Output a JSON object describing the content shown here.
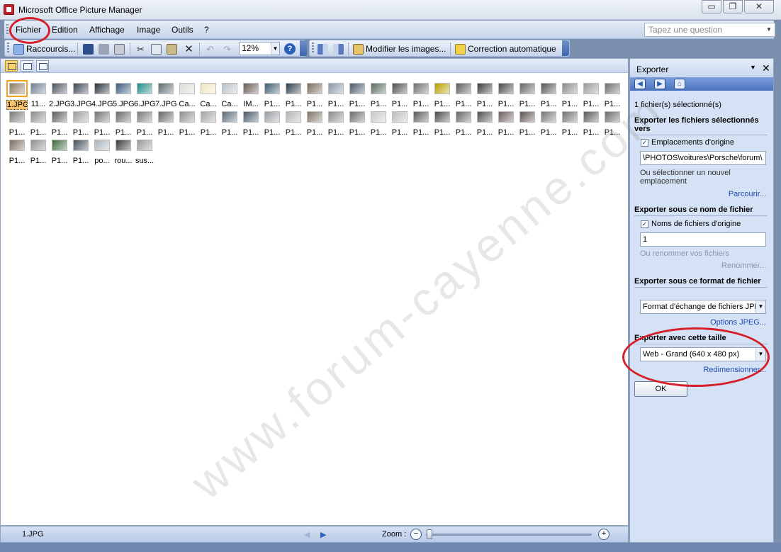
{
  "window": {
    "title": "Microsoft Office Picture Manager",
    "min_label": "▭",
    "restore_label": "❐",
    "close_label": "✕"
  },
  "menu": {
    "items": [
      {
        "label": "Fichier"
      },
      {
        "label": "Edition"
      },
      {
        "label": "Affichage"
      },
      {
        "label": "Image"
      },
      {
        "label": "Outils"
      },
      {
        "label": "?"
      }
    ],
    "ask_placeholder": "Tapez une question"
  },
  "toolbar": {
    "shortcuts_label": "Raccourcis...",
    "zoom_value": "12%",
    "edit_images_label": "Modifier les images...",
    "auto_correct_label": "Correction automatique"
  },
  "thumbnails": [
    {
      "caption": "1.JPG",
      "color": "#8c7a62",
      "selected": true
    },
    {
      "caption": "11...",
      "color": "#6f7f8f"
    },
    {
      "caption": "2.JPG",
      "color": "#4c5660"
    },
    {
      "caption": "3.JPG",
      "color": "#3c4654"
    },
    {
      "caption": "4.JPG",
      "color": "#28323c"
    },
    {
      "caption": "5.JPG",
      "color": "#3a5a7a"
    },
    {
      "caption": "6.JPG",
      "color": "#1f8a88"
    },
    {
      "caption": "7.JPG",
      "color": "#5e6a70"
    },
    {
      "caption": "Ca...",
      "color": "#d9dcd6"
    },
    {
      "caption": "Ca...",
      "color": "#efe6c2"
    },
    {
      "caption": "Ca...",
      "color": "#b8c2c8"
    },
    {
      "caption": "IM...",
      "color": "#6a5a52"
    },
    {
      "caption": "P1...",
      "color": "#3e5c6c"
    },
    {
      "caption": "P1...",
      "color": "#2e3e4a"
    },
    {
      "caption": "P1...",
      "color": "#7a6a5a"
    },
    {
      "caption": "P1...",
      "color": "#8a98a6"
    },
    {
      "caption": "P1...",
      "color": "#4a5866"
    },
    {
      "caption": "P1...",
      "color": "#5a6a5e"
    },
    {
      "caption": "P1...",
      "color": "#4e4e4e"
    },
    {
      "caption": "P1...",
      "color": "#707070"
    },
    {
      "caption": "P1...",
      "color": "#b8a000"
    },
    {
      "caption": "P1...",
      "color": "#5c5c5c"
    },
    {
      "caption": "P1...",
      "color": "#3c3c3c"
    },
    {
      "caption": "P1...",
      "color": "#4a4a4a"
    },
    {
      "caption": "P1...",
      "color": "#666666"
    },
    {
      "caption": "P1...",
      "color": "#555555"
    },
    {
      "caption": "P1...",
      "color": "#8a8a8a"
    },
    {
      "caption": "P1...",
      "color": "#9a9a9a"
    },
    {
      "caption": "P1...",
      "color": "#6e6e6e"
    },
    {
      "caption": "P1...",
      "color": "#7a7a7a"
    },
    {
      "caption": "P1...",
      "color": "#8c8c8c"
    },
    {
      "caption": "P1...",
      "color": "#5e5e5e"
    },
    {
      "caption": "P1...",
      "color": "#9e9e9e"
    },
    {
      "caption": "P1...",
      "color": "#747474"
    },
    {
      "caption": "P1...",
      "color": "#6a6a6a"
    },
    {
      "caption": "P1...",
      "color": "#7c7c7c"
    },
    {
      "caption": "P1...",
      "color": "#686868"
    },
    {
      "caption": "P1...",
      "color": "#8e8e8e"
    },
    {
      "caption": "P1...",
      "color": "#a4a4a4"
    },
    {
      "caption": "P1...",
      "color": "#5a6a7a"
    },
    {
      "caption": "P1...",
      "color": "#4a5a6a"
    },
    {
      "caption": "P1...",
      "color": "#9aa0a6"
    },
    {
      "caption": "P1...",
      "color": "#b4b4b4"
    },
    {
      "caption": "P1...",
      "color": "#7e746a"
    },
    {
      "caption": "P1...",
      "color": "#8a8a8a"
    },
    {
      "caption": "P1...",
      "color": "#6c6c6c"
    },
    {
      "caption": "P1...",
      "color": "#c8c8c8"
    },
    {
      "caption": "P1...",
      "color": "#bcbcbc"
    },
    {
      "caption": "P1...",
      "color": "#5c5c5c"
    },
    {
      "caption": "P1...",
      "color": "#4c4c4c"
    },
    {
      "caption": "P1...",
      "color": "#666666"
    },
    {
      "caption": "P1...",
      "color": "#505050"
    },
    {
      "caption": "P1...",
      "color": "#6e5e5e"
    },
    {
      "caption": "P1...",
      "color": "#5e5252"
    },
    {
      "caption": "P1...",
      "color": "#787878"
    },
    {
      "caption": "P1...",
      "color": "#727272"
    },
    {
      "caption": "P1...",
      "color": "#5a5a5a"
    },
    {
      "caption": "P1...",
      "color": "#6a6a6a"
    },
    {
      "caption": "P1...",
      "color": "#7a6c64"
    },
    {
      "caption": "P1...",
      "color": "#8e8e8e"
    },
    {
      "caption": "P1...",
      "color": "#3e6a3e"
    },
    {
      "caption": "P1...",
      "color": "#44525e"
    },
    {
      "caption": "po...",
      "color": "#aab4bc"
    },
    {
      "caption": "rou...",
      "color": "#3a3a3a"
    },
    {
      "caption": "sus...",
      "color": "#9a9a9a"
    }
  ],
  "statusbar": {
    "file": "1.JPG",
    "zoom_label": "Zoom :",
    "minus": "−",
    "plus": "+",
    "zoom_fraction": 0.0
  },
  "taskpane": {
    "title": "Exporter",
    "selected_count": "1 fichier(s) sélectionné(s)",
    "section1_title": "Exporter les fichiers sélectionnés vers",
    "orig_location_label": "Emplacements d'origine",
    "orig_location_checked": true,
    "path_value": "\\PHOTOS\\voitures\\Porsche\\forum\\",
    "new_location_hint": "Ou sélectionner un nouvel emplacement",
    "browse_link": "Parcourir...",
    "section2_title": "Exporter sous ce nom de fichier",
    "orig_names_label": "Noms de fichiers d'origine",
    "orig_names_checked": true,
    "name_value": "1",
    "rename_hint": "Ou renommer vos fichiers",
    "rename_link": "Renommer...",
    "section3_title": "Exporter sous ce format de fichier",
    "format_value": "Format d'échange de fichiers JPEG",
    "jpeg_options_link": "Options JPEG...",
    "section4_title": "Exporter avec cette taille",
    "size_value": "Web - Grand (640 x 480 px)",
    "resize_link": "Redimensionner...",
    "ok_label": "OK"
  },
  "watermark": "www.forum-cayenne.com",
  "colors": {
    "annotation": "#d61f2b",
    "selection": "#f5a11e",
    "link": "#1e4cb0"
  }
}
